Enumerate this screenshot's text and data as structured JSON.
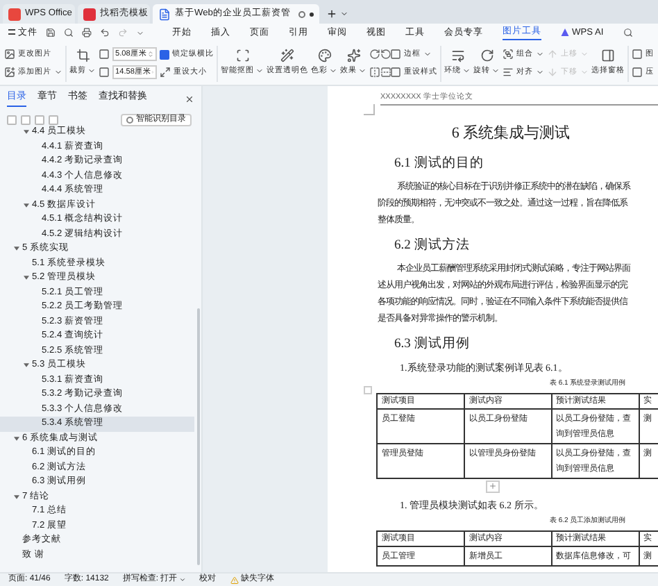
{
  "tabs": [
    {
      "label": "WPS Office",
      "kind": "app",
      "selected": false
    },
    {
      "label": "找稻壳模板",
      "kind": "template",
      "selected": false
    },
    {
      "label": "基于Web的企业员工薪资管",
      "kind": "doc",
      "selected": true
    }
  ],
  "menu": {
    "file": "文件",
    "items": [
      {
        "label": "开始",
        "selected": false
      },
      {
        "label": "插入",
        "selected": false
      },
      {
        "label": "页面",
        "selected": false
      },
      {
        "label": "引用",
        "selected": false
      },
      {
        "label": "审阅",
        "selected": false
      },
      {
        "label": "视图",
        "selected": false
      },
      {
        "label": "工具",
        "selected": false
      },
      {
        "label": "会员专享",
        "selected": false
      },
      {
        "label": "图片工具",
        "selected": true
      }
    ],
    "ai": "WPS AI"
  },
  "ribbon": [
    {
      "items": [
        {
          "kind": "pair",
          "rows": [
            {
              "label": "更改图片",
              "dropdown": false
            },
            {
              "label": "添加图片",
              "dropdown": true
            }
          ]
        }
      ]
    },
    {
      "items": [
        {
          "kind": "big",
          "label": "裁剪",
          "dropdown": true
        },
        {
          "kind": "fields",
          "rows": [
            {
              "value": "5.08厘米"
            },
            {
              "value": "14.58厘米"
            }
          ]
        },
        {
          "kind": "pair",
          "rows": [
            {
              "kind": "checkbox",
              "label": "锁定纵横比",
              "checked": true
            },
            {
              "label": "重设大小",
              "dropdown": false
            }
          ]
        }
      ]
    },
    {
      "items": [
        {
          "kind": "big",
          "label": "智能抠图",
          "dropdown": true
        },
        {
          "kind": "big",
          "label": "设置透明色",
          "dropdown": false
        },
        {
          "kind": "big",
          "label": "色彩",
          "dropdown": true
        },
        {
          "kind": "big",
          "label": "效果",
          "dropdown": true
        },
        {
          "kind": "icons"
        },
        {
          "kind": "pair",
          "rows": [
            {
              "label": "边框",
              "dropdown": true
            },
            {
              "label": "重设样式",
              "dropdown": false
            }
          ]
        }
      ]
    },
    {
      "items": [
        {
          "kind": "big",
          "label": "环绕",
          "dropdown": true
        },
        {
          "kind": "big",
          "label": "旋转",
          "dropdown": true
        },
        {
          "kind": "pair",
          "rows": [
            {
              "label": "组合",
              "dropdown": true
            },
            {
              "label": "对齐",
              "dropdown": true
            }
          ]
        },
        {
          "kind": "pair",
          "rows": [
            {
              "label": "上移",
              "dropdown": true,
              "disabled": true
            },
            {
              "label": "下移",
              "dropdown": true,
              "disabled": true
            }
          ]
        },
        {
          "kind": "big",
          "label": "选择窗格",
          "dropdown": false
        }
      ]
    },
    {
      "items": [
        {
          "kind": "pair",
          "rows": [
            {
              "label": "图"
            },
            {
              "label": "压"
            }
          ]
        }
      ]
    }
  ],
  "nav": {
    "tabs": [
      {
        "label": "目录",
        "selected": true
      },
      {
        "label": "章节",
        "selected": false
      },
      {
        "label": "书签",
        "selected": false
      },
      {
        "label": "查找和替换",
        "selected": false
      }
    ],
    "smart_button": "智能识别目录",
    "tree_above": [
      {
        "label": "4.4 员工模块",
        "expanded": true,
        "selected": false,
        "children": [
          {
            "label": "4.4.1 薪资查询",
            "selected": false
          },
          {
            "label": "4.4.2 考勤记录查询",
            "selected": false
          },
          {
            "label": "4.4.3 个人信息修改",
            "selected": false
          },
          {
            "label": "4.4.4 系统管理",
            "selected": false
          }
        ]
      },
      {
        "label": "4.5 数据库设计",
        "expanded": true,
        "selected": false,
        "children": [
          {
            "label": "4.5.1 概念结构设计",
            "selected": false
          },
          {
            "label": "4.5.2 逻辑结构设计",
            "selected": false
          }
        ]
      }
    ],
    "tree": [
      {
        "label": "5 系统实现",
        "expanded": true,
        "selected": false,
        "children": [
          {
            "label": "5.1 系统登录模块",
            "selected": false
          },
          {
            "label": "5.2 管理员模块",
            "expanded": true,
            "selected": false,
            "children": [
              {
                "label": "5.2.1 员工管理",
                "selected": false
              },
              {
                "label": "5.2.2 员工考勤管理",
                "selected": false
              },
              {
                "label": "5.2.3 薪资管理",
                "selected": false
              },
              {
                "label": "5.2.4 查询统计",
                "selected": false
              },
              {
                "label": "5.2.5 系统管理",
                "selected": false
              }
            ]
          },
          {
            "label": "5.3 员工模块",
            "expanded": true,
            "selected": false,
            "children": [
              {
                "label": "5.3.1 薪资查询",
                "selected": false
              },
              {
                "label": "5.3.2 考勤记录查询",
                "selected": false
              },
              {
                "label": "5.3.3 个人信息修改",
                "selected": false
              },
              {
                "label": "5.3.4 系统管理",
                "selected": true
              }
            ]
          }
        ]
      },
      {
        "label": "6 系统集成与测试",
        "expanded": true,
        "selected": false,
        "children": [
          {
            "label": "6.1 测试的目的",
            "selected": false
          },
          {
            "label": "6.2 测试方法",
            "selected": false
          },
          {
            "label": "6.3 测试用例",
            "selected": false
          }
        ]
      },
      {
        "label": "7 结论",
        "expanded": true,
        "selected": false,
        "children": [
          {
            "label": "7.1 总结",
            "selected": false
          },
          {
            "label": "7.2 展望",
            "selected": false
          }
        ]
      },
      {
        "label": "参考文献",
        "selected": false
      },
      {
        "label": "致 谢",
        "selected": false
      }
    ]
  },
  "document": {
    "header": "XXXXXXXX 学士学位论文",
    "title": "6 系统集成与测试",
    "blocks": [
      {
        "kind": "heading",
        "text": "6.1 测试的目的"
      },
      {
        "kind": "paragraph",
        "lines": [
          "系统验证的核心目标在于识别并修正系统中的潜在缺陷，确保系",
          "阶段的预期相符，无冲突或不一致之处。通过这一过程，旨在降低系",
          "整体质量。"
        ]
      },
      {
        "kind": "heading",
        "text": "6.2 测试方法"
      },
      {
        "kind": "paragraph",
        "lines": [
          "本企业员工薪酬管理系统采用封闭式测试策略，专注于网站界面",
          "述从用户视角出发，对网站的外观布局进行评估，检验界面显示的完",
          "各项功能的响应情况。同时，验证在不同输入条件下系统能否提供信",
          "是否具备对异常操作的警示机制。"
        ]
      },
      {
        "kind": "heading",
        "text": "6.3 测试用例"
      },
      {
        "kind": "line",
        "text": "1.系统登录功能的测试案例详见表 6.1。"
      },
      {
        "kind": "caption",
        "text": "表 6.1 系统登录测试用例"
      },
      {
        "kind": "table",
        "columns": [
          "测试项目",
          "测试内容",
          "预计测试结果",
          "实"
        ],
        "rows": [
          [
            "员工登陆",
            "以员工身份登陆",
            "以员工身份登陆，查询到管理员信息",
            "测"
          ],
          [
            "管理员登陆",
            "以管理员身份登陆",
            "以员工身份登陆，查询到管理员信息",
            "测"
          ]
        ]
      },
      {
        "kind": "add"
      },
      {
        "kind": "line",
        "text": "1.  管理员模块测试如表 6.2 所示。"
      },
      {
        "kind": "caption",
        "text": "表 6.2 员工添加测试用例"
      },
      {
        "kind": "table",
        "columns": [
          "测试项目",
          "测试内容",
          "预计测试结果",
          "实"
        ],
        "rows": [
          [
            "员工管理",
            "新增员工",
            "数据库信息修改，可",
            "测"
          ]
        ]
      }
    ]
  },
  "status": {
    "page": "页面: 41/46",
    "words": "字数: 14132",
    "spell": "拼写检查: 打开",
    "proof": "校对",
    "font": "缺失字体"
  }
}
